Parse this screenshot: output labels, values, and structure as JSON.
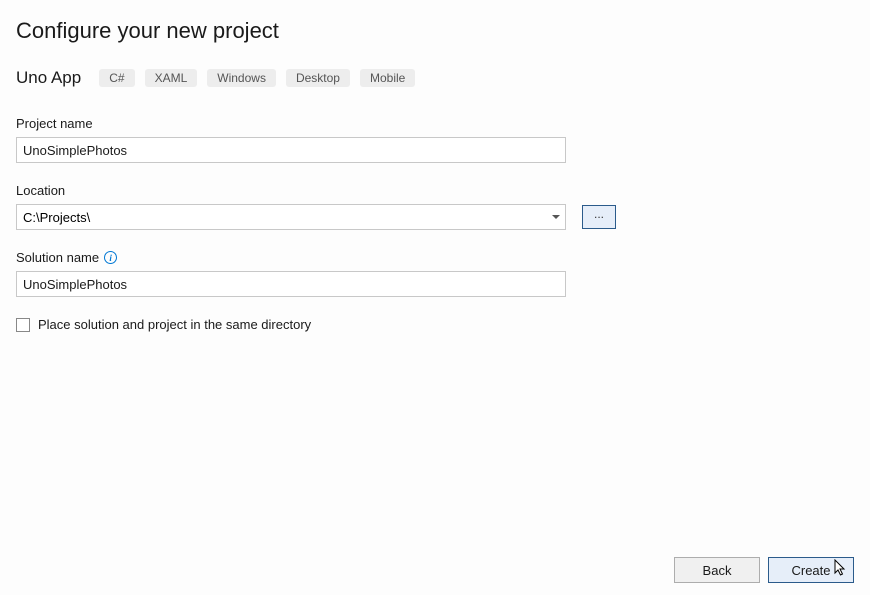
{
  "header": {
    "page_title": "Configure your new project",
    "template_name": "Uno App",
    "tags": [
      "C#",
      "XAML",
      "Windows",
      "Desktop",
      "Mobile"
    ]
  },
  "fields": {
    "project_name": {
      "label": "Project name",
      "value": "UnoSimplePhotos"
    },
    "location": {
      "label": "Location",
      "value": "C:\\Projects\\",
      "browse_label": "..."
    },
    "solution_name": {
      "label": "Solution name",
      "value": "UnoSimplePhotos"
    },
    "same_directory": {
      "label": "Place solution and project in the same directory",
      "checked": false
    }
  },
  "footer": {
    "back_label": "Back",
    "create_label": "Create"
  }
}
